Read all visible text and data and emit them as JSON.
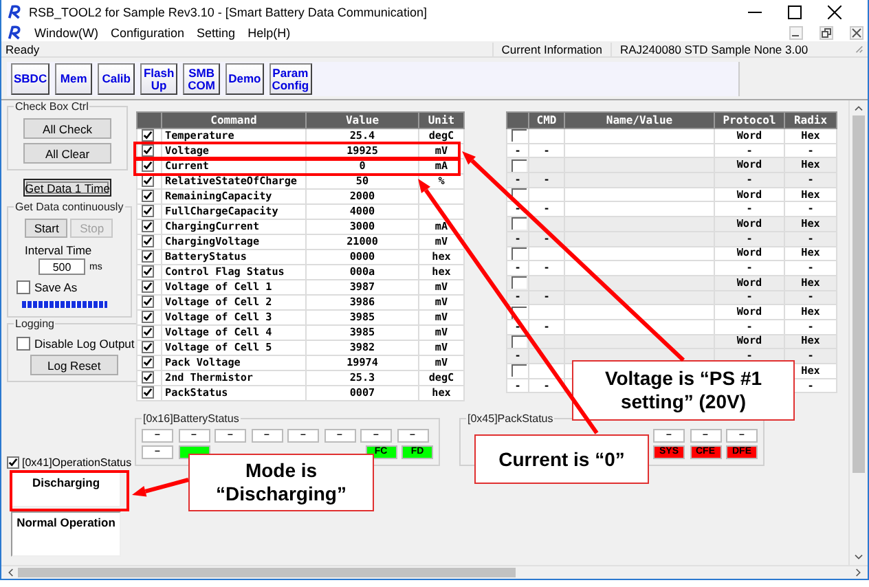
{
  "window": {
    "title": "RSB_TOOL2 for Sample Rev3.10 - [Smart Battery Data Communication]"
  },
  "menu": [
    "Window(W)",
    "Configuration",
    "Setting",
    "Help(H)"
  ],
  "status_bar": {
    "text": "Ready",
    "info_label": "Current Information",
    "info_value": "RAJ240080 STD Sample None 3.00"
  },
  "toolbar": [
    {
      "lines": [
        "SBDC"
      ]
    },
    {
      "lines": [
        "Mem"
      ]
    },
    {
      "lines": [
        "Calib"
      ]
    },
    {
      "lines": [
        "Flash",
        "Up"
      ]
    },
    {
      "lines": [
        "SMB",
        "COM"
      ]
    },
    {
      "lines": [
        "Demo"
      ]
    },
    {
      "lines": [
        "Param",
        "Config"
      ]
    }
  ],
  "check_box_ctrl": {
    "title": "Check Box Ctrl",
    "buttons": [
      "All Check",
      "All Clear"
    ]
  },
  "get_data_once": "Get Data 1 Time",
  "continuous": {
    "title": "Get Data continuously",
    "start": {
      "label": "Start",
      "disabled": false
    },
    "stop": {
      "label": "Stop",
      "disabled": true
    },
    "interval_label": "Interval Time",
    "interval_value": "500",
    "interval_unit": "ms",
    "save_as": {
      "label": "Save As",
      "checked": false
    },
    "level": 1
  },
  "logging": {
    "title": "Logging",
    "disable_log": {
      "label": "Disable Log Output",
      "checked": false
    },
    "reset": "Log Reset"
  },
  "operation_status": {
    "label": "[0x41]OperationStatus",
    "checked": true,
    "mode": "Discharging",
    "state": "Normal Operation"
  },
  "commands": {
    "columns": [
      "Command",
      "Value",
      "Unit"
    ],
    "rows": [
      {
        "checked": true,
        "command": "Temperature",
        "value": "25.4",
        "unit": "degC"
      },
      {
        "checked": true,
        "command": "Voltage",
        "value": "19925",
        "unit": "mV"
      },
      {
        "checked": true,
        "command": "Current",
        "value": "0",
        "unit": "mA"
      },
      {
        "checked": true,
        "command": "RelativeStateOfCharge",
        "value": "50",
        "unit": "%"
      },
      {
        "checked": true,
        "command": "RemainingCapacity",
        "value": "2000"
      },
      {
        "checked": true,
        "command": "FullChargeCapacity",
        "value": "4000"
      },
      {
        "checked": true,
        "command": "ChargingCurrent",
        "value": "3000",
        "unit": "mA"
      },
      {
        "checked": true,
        "command": "ChargingVoltage",
        "value": "21000",
        "unit": "mV"
      },
      {
        "checked": true,
        "command": "BatteryStatus",
        "value": "0000",
        "unit": "hex"
      },
      {
        "checked": true,
        "command": "Control Flag Status",
        "value": "000a",
        "unit": "hex"
      },
      {
        "checked": true,
        "command": "Voltage of Cell 1",
        "value": "3987",
        "unit": "mV"
      },
      {
        "checked": true,
        "command": "Voltage of Cell 2",
        "value": "3986",
        "unit": "mV"
      },
      {
        "checked": true,
        "command": "Voltage of Cell 3",
        "value": "3985",
        "unit": "mV"
      },
      {
        "checked": true,
        "command": "Voltage of Cell 4",
        "value": "3985",
        "unit": "mV"
      },
      {
        "checked": true,
        "command": "Voltage of Cell 5",
        "value": "3982",
        "unit": "mV"
      },
      {
        "checked": true,
        "command": "Pack Voltage",
        "value": "19974",
        "unit": "mV"
      },
      {
        "checked": true,
        "command": "2nd Thermistor",
        "value": "25.3",
        "unit": "degC"
      },
      {
        "checked": true,
        "command": "PackStatus",
        "value": "0007",
        "unit": "hex"
      }
    ]
  },
  "custom_commands": {
    "columns": [
      "CMD",
      "Name/Value",
      "Protocol",
      "Radix"
    ],
    "rows": [
      {
        "kind": "entry",
        "checked": false,
        "protocol": "Word",
        "radix": "Hex"
      },
      {
        "kind": "dash",
        "mark": "-",
        "cmd": "-",
        "protocol": "-",
        "radix": "-"
      },
      {
        "kind": "entry",
        "checked": false,
        "protocol": "Word",
        "radix": "Hex"
      },
      {
        "kind": "dash",
        "mark": "-",
        "cmd": "-",
        "protocol": "-",
        "radix": "-"
      },
      {
        "kind": "entry",
        "checked": false,
        "protocol": "Word",
        "radix": "Hex"
      },
      {
        "kind": "dash",
        "mark": "-",
        "cmd": "-",
        "protocol": "-",
        "radix": "-"
      },
      {
        "kind": "entry",
        "checked": false,
        "protocol": "Word",
        "radix": "Hex"
      },
      {
        "kind": "dash",
        "mark": "-",
        "cmd": "-",
        "protocol": "-",
        "radix": "-"
      },
      {
        "kind": "entry",
        "checked": false,
        "protocol": "Word",
        "radix": "Hex"
      },
      {
        "kind": "dash",
        "mark": "-",
        "cmd": "-",
        "protocol": "-",
        "radix": "-"
      },
      {
        "kind": "entry",
        "checked": false,
        "protocol": "Word",
        "radix": "Hex"
      },
      {
        "kind": "dash",
        "mark": "-",
        "cmd": "-",
        "protocol": "-",
        "radix": "-"
      },
      {
        "kind": "entry",
        "checked": false,
        "protocol": "Word",
        "radix": "Hex"
      },
      {
        "kind": "dash",
        "mark": "-",
        "cmd": "-",
        "protocol": "-",
        "radix": "-"
      },
      {
        "kind": "entry",
        "checked": false,
        "protocol": "Word",
        "radix": "Hex"
      },
      {
        "kind": "dash",
        "mark": "-",
        "protocol": "-",
        "radix": "-"
      },
      {
        "kind": "entry",
        "checked": false,
        "radix": "Hex"
      },
      {
        "kind": "dash",
        "mark": "-",
        "cmd": "-",
        "radix": "-"
      }
    ]
  },
  "battery_status": {
    "label": "[0x16]BatteryStatus",
    "rows": [
      {
        "left": [
          {
            "text": "–"
          },
          {
            "text": "–"
          },
          {
            "text": "–"
          },
          {
            "text": "–"
          },
          {
            "text": "–"
          },
          {
            "text": "–"
          },
          {
            "text": "–"
          },
          {
            "text": "–"
          }
        ]
      },
      {
        "left": [
          {
            "text": "–"
          },
          {
            "color": "#00ff00"
          }
        ],
        "right": [
          {
            "text": "FC",
            "color": "#00ff00"
          },
          {
            "text": "FD",
            "color": "#00ff00"
          }
        ]
      }
    ]
  },
  "pack_status": {
    "label": "[0x45]PackStatus",
    "rows": [
      {
        "right": [
          {
            "text": "–"
          },
          {
            "text": "–"
          },
          {
            "text": "–"
          }
        ]
      },
      {
        "right": [
          {
            "text": "SYS",
            "color": "#ff0000"
          },
          {
            "text": "CFE",
            "color": "#ff0000"
          },
          {
            "text": "DFE",
            "color": "#ff0000"
          }
        ]
      }
    ]
  },
  "annotations": [
    {
      "text": "Voltage is “PS #1 setting” (20V)"
    },
    {
      "text": "Current is “0”"
    },
    {
      "text": "Mode is “Discharging”"
    }
  ]
}
